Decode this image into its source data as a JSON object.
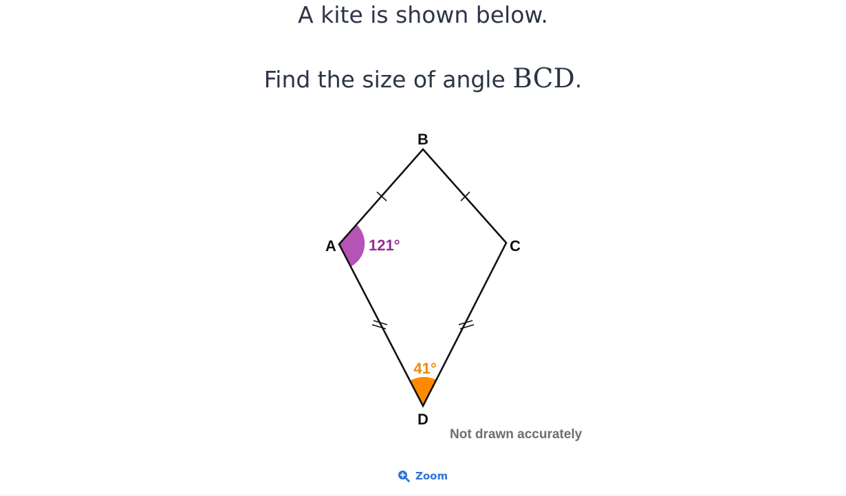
{
  "question": {
    "line1": "A kite is shown below.",
    "line2_prefix": "Find the size of angle ",
    "line2_math": "BCD",
    "line2_suffix": "."
  },
  "diagram": {
    "vertex_labels": {
      "A": "A",
      "B": "B",
      "C": "C",
      "D": "D"
    },
    "angle_at_A": "121°",
    "angle_at_D": "41°",
    "note": "Not drawn accurately",
    "colors": {
      "outline": "#111111",
      "angle_A_fill": "#b553b6",
      "angle_A_text": "#952a95",
      "angle_D_fill": "#ff8a00",
      "angle_D_text": "#f0880a",
      "note_text": "#6d6e72"
    }
  },
  "zoom": {
    "label": "Zoom",
    "icon": "zoom-in-icon",
    "color": "#2f73d6"
  }
}
